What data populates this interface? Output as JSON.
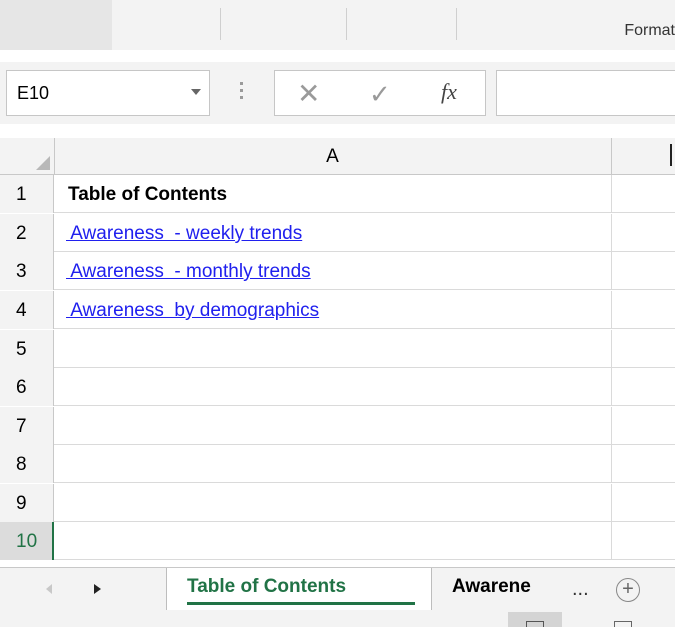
{
  "ribbon": {
    "visible_label": "Format"
  },
  "formula_bar": {
    "name_box": "E10",
    "cancel_icon": "close-icon",
    "enter_icon": "check-icon",
    "function_label": "fx",
    "formula_value": ""
  },
  "grid": {
    "columns": [
      "A"
    ],
    "rows": [
      {
        "num": "1",
        "a": "Table of Contents",
        "style": "bold"
      },
      {
        "num": "2",
        "a": " Awareness  - weekly trends",
        "style": "link"
      },
      {
        "num": "3",
        "a": " Awareness  - monthly trends",
        "style": "link"
      },
      {
        "num": "4",
        "a": " Awareness  by demographics",
        "style": "link"
      },
      {
        "num": "5",
        "a": "",
        "style": ""
      },
      {
        "num": "6",
        "a": "",
        "style": ""
      },
      {
        "num": "7",
        "a": "",
        "style": ""
      },
      {
        "num": "8",
        "a": "",
        "style": ""
      },
      {
        "num": "9",
        "a": "",
        "style": ""
      },
      {
        "num": "10",
        "a": "",
        "style": ""
      }
    ],
    "active_row": "10"
  },
  "sheet_tabs": {
    "active": "Table of Contents",
    "next": "Awarene",
    "overflow": "...",
    "add": "+"
  },
  "colors": {
    "excel_green": "#217346",
    "link_blue": "#2020ee"
  }
}
